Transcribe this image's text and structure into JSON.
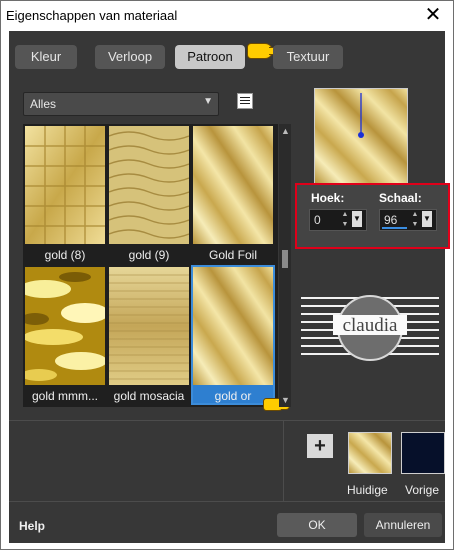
{
  "window": {
    "title": "Eigenschappen van materiaal",
    "close_glyph": "✕"
  },
  "tabs": [
    {
      "label": "Kleur",
      "active": false
    },
    {
      "label": "Verloop",
      "active": false
    },
    {
      "label": "Patroon",
      "active": true
    },
    {
      "label": "Textuur",
      "active": false
    }
  ],
  "category": {
    "selected": "Alles"
  },
  "patterns": [
    {
      "label": "gold (8)",
      "style": "tiles"
    },
    {
      "label": "gold (9)",
      "style": "waves"
    },
    {
      "label": "Gold Foil",
      "style": "diagonal"
    },
    {
      "label": "gold mmm...",
      "style": "bright"
    },
    {
      "label": "gold mosacia",
      "style": "mosaic"
    },
    {
      "label": "gold or",
      "style": "diagonal",
      "selected": true
    }
  ],
  "angle": {
    "label": "Hoek:",
    "value": "0"
  },
  "scale": {
    "label": "Schaal:",
    "value": "96",
    "level_percent": 96
  },
  "watermark": {
    "text": "claudia"
  },
  "swatches": {
    "current_label": "Huidige",
    "previous_label": "Vorige",
    "previous_color": "#06102a"
  },
  "footer": {
    "help": "Help",
    "ok": "OK",
    "cancel": "Annuleren"
  },
  "colors": {
    "highlight": "#e0001a",
    "selection": "#2e7fd0"
  }
}
